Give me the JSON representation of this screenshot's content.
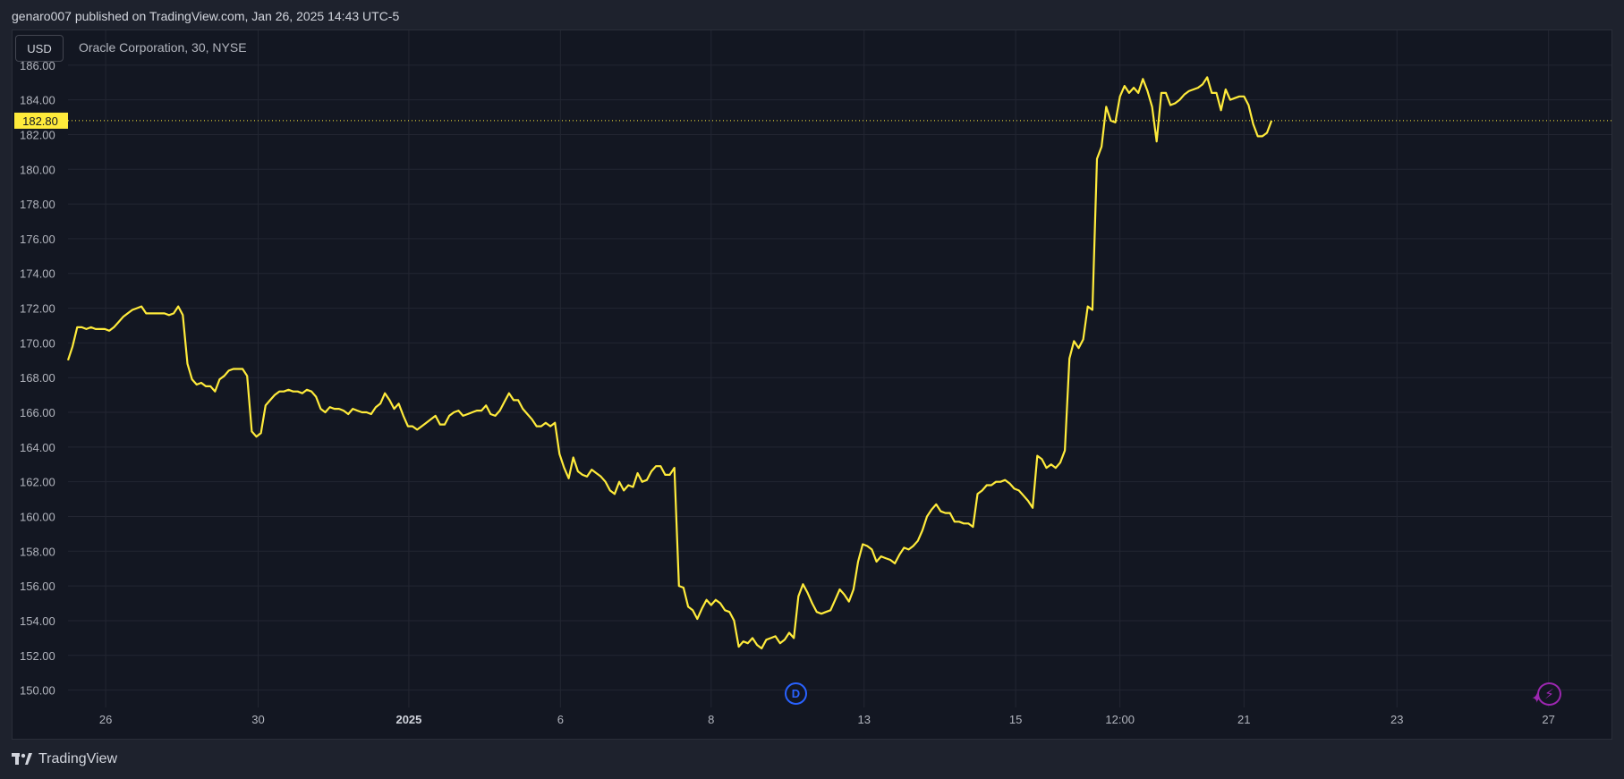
{
  "header": {
    "publisher": "genaro007 published on TradingView.com, Jan 26, 2025 14:43 UTC-5"
  },
  "legend": {
    "currency": "USD",
    "symbol": "Oracle Corporation, 30, NYSE"
  },
  "footer": {
    "brand": "TradingView"
  },
  "markers": {
    "dividend": "D",
    "earnings": "⚡"
  },
  "colors": {
    "background": "#131722",
    "frame": "#1e222d",
    "grid": "#232632",
    "line": "#ffeb3b",
    "text": "#d1d4dc",
    "dividend_marker": "#2962ff",
    "earnings_marker": "#9c27b0"
  },
  "chart_data": {
    "type": "line",
    "title": "",
    "xlabel": "",
    "ylabel": "",
    "ylim": [
      149,
      188
    ],
    "last_price": 182.8,
    "last_price_label": "182.80",
    "yticks": [
      "150.00",
      "152.00",
      "154.00",
      "156.00",
      "158.00",
      "160.00",
      "162.00",
      "164.00",
      "166.00",
      "168.00",
      "170.00",
      "172.00",
      "174.00",
      "176.00",
      "178.00",
      "180.00",
      "182.00",
      "184.00",
      "186.00"
    ],
    "xticks": [
      "26",
      "30",
      "2025",
      "6",
      "8",
      "13",
      "15",
      "12:00",
      "21",
      "23",
      "27"
    ],
    "xticks_bold": [
      "2025"
    ],
    "xtick_index": [
      8.2,
      41.4,
      74.2,
      107.2,
      140.0,
      173.3,
      206.3,
      229.0,
      256.0,
      289.3,
      322.3
    ],
    "xlim_index": [
      0,
      336
    ],
    "grid": true,
    "series": [
      {
        "name": "",
        "values": [
          169.0,
          169.8,
          170.9,
          170.9,
          170.8,
          170.9,
          170.8,
          170.8,
          170.8,
          170.7,
          170.9,
          171.2,
          171.5,
          171.7,
          171.9,
          172.0,
          172.1,
          171.7,
          171.7,
          171.7,
          171.7,
          171.7,
          171.6,
          171.7,
          172.1,
          171.6,
          168.8,
          167.9,
          167.6,
          167.7,
          167.5,
          167.5,
          167.2,
          167.9,
          168.1,
          168.4,
          168.5,
          168.5,
          168.5,
          168.1,
          164.9,
          164.6,
          164.8,
          166.4,
          166.7,
          167.0,
          167.2,
          167.2,
          167.3,
          167.2,
          167.2,
          167.1,
          167.3,
          167.2,
          166.9,
          166.2,
          166.0,
          166.3,
          166.2,
          166.2,
          166.1,
          165.9,
          166.2,
          166.1,
          166.0,
          166.0,
          165.9,
          166.3,
          166.5,
          167.1,
          166.7,
          166.2,
          166.5,
          165.8,
          165.2,
          165.2,
          165.0,
          165.2,
          165.4,
          165.6,
          165.8,
          165.3,
          165.3,
          165.8,
          166.0,
          166.1,
          165.8,
          165.9,
          166.0,
          166.1,
          166.1,
          166.4,
          165.9,
          165.8,
          166.1,
          166.6,
          167.1,
          166.7,
          166.7,
          166.2,
          165.9,
          165.6,
          165.2,
          165.2,
          165.4,
          165.2,
          165.4,
          163.6,
          162.8,
          162.2,
          163.4,
          162.6,
          162.4,
          162.3,
          162.7,
          162.5,
          162.3,
          162.0,
          161.5,
          161.3,
          162.0,
          161.5,
          161.8,
          161.7,
          162.5,
          162.0,
          162.1,
          162.6,
          162.9,
          162.9,
          162.4,
          162.4,
          162.8,
          156.0,
          155.9,
          154.8,
          154.6,
          154.1,
          154.7,
          155.2,
          154.9,
          155.2,
          155.0,
          154.6,
          154.5,
          154.0,
          152.5,
          152.8,
          152.7,
          153.0,
          152.6,
          152.4,
          152.9,
          153.0,
          153.1,
          152.7,
          152.9,
          153.3,
          153.0,
          155.4,
          156.1,
          155.6,
          155.0,
          154.5,
          154.4,
          154.5,
          154.6,
          155.2,
          155.8,
          155.5,
          155.1,
          155.8,
          157.4,
          158.4,
          158.3,
          158.1,
          157.4,
          157.7,
          157.6,
          157.5,
          157.3,
          157.8,
          158.2,
          158.1,
          158.3,
          158.6,
          159.2,
          160.0,
          160.4,
          160.7,
          160.3,
          160.2,
          160.2,
          159.7,
          159.7,
          159.6,
          159.6,
          159.4,
          161.3,
          161.5,
          161.8,
          161.8,
          162.0,
          162.0,
          162.1,
          161.9,
          161.6,
          161.5,
          161.2,
          160.9,
          160.5,
          163.5,
          163.3,
          162.8,
          163.0,
          162.8,
          163.1,
          163.8,
          169.1,
          170.1,
          169.7,
          170.2,
          172.1,
          171.9,
          180.6,
          181.3,
          183.6,
          182.8,
          182.7,
          184.2,
          184.8,
          184.4,
          184.7,
          184.4,
          185.2,
          184.5,
          183.6,
          181.6,
          184.4,
          184.4,
          183.7,
          183.8,
          184.0,
          184.3,
          184.5,
          184.6,
          184.7,
          184.9,
          185.3,
          184.4,
          184.4,
          183.4,
          184.6,
          184.0,
          184.1,
          184.2,
          184.2,
          183.7,
          182.6,
          181.9,
          181.9,
          182.1,
          182.8
        ]
      }
    ]
  }
}
